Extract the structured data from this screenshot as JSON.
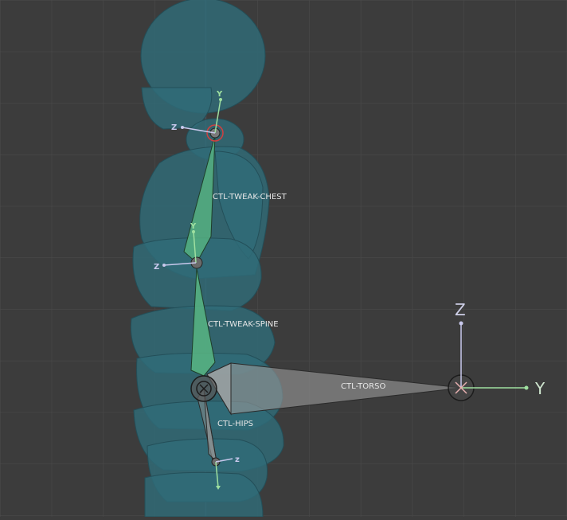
{
  "viewport": {
    "bones": {
      "chest": "CTL-TWEAK-CHEST",
      "spine": "CTL-TWEAK-SPINE",
      "torso": "CTL-TORSO",
      "hips": "CTL-HIPS"
    },
    "axes": {
      "world_z": "Z",
      "world_y": "Y",
      "chest_y": "Y",
      "chest_z": "Z",
      "spine_y": "Y",
      "spine_z": "Z",
      "hips_z": "z"
    }
  },
  "colors": {
    "background": "#3c3c3c",
    "grid": "#4a4a4a",
    "body_fill": "#2f6b78",
    "bone_green": "#58b582",
    "bone_gray": "#8a8a8a",
    "axis_y": "#9fe0a0",
    "axis_z": "#c8c8ec"
  }
}
